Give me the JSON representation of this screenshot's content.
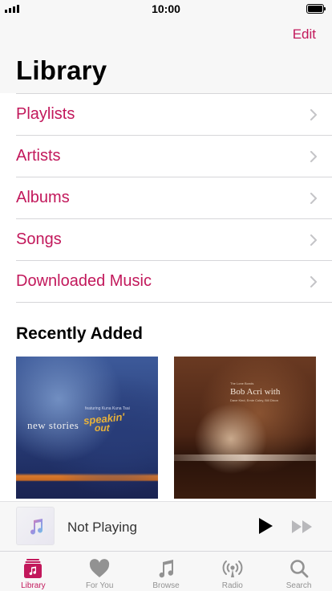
{
  "status_bar": {
    "time": "10:00"
  },
  "header": {
    "edit_label": "Edit",
    "title": "Library"
  },
  "menu": {
    "items": [
      {
        "label": "Playlists"
      },
      {
        "label": "Artists"
      },
      {
        "label": "Albums"
      },
      {
        "label": "Songs"
      },
      {
        "label": "Downloaded Music"
      }
    ]
  },
  "recently_added": {
    "title": "Recently Added",
    "albums": [
      {
        "cover_text_main": "new stories",
        "cover_text_accent_1": "speakin'",
        "cover_text_accent_2": "out",
        "cover_small_text": "featuring Kuna Kuna Tsai"
      },
      {
        "cover_small_top": "The Lone Bonds",
        "cover_text_main": "Bob Acri with",
        "cover_small_text": "Dave Kind, Ernie Coley, Bill Dixon"
      }
    ]
  },
  "mini_player": {
    "status": "Not Playing"
  },
  "tab_bar": {
    "active": "Library",
    "tabs": [
      {
        "label": "Library",
        "icon": "library-icon"
      },
      {
        "label": "For You",
        "icon": "heart-icon"
      },
      {
        "label": "Browse",
        "icon": "music-note-icon"
      },
      {
        "label": "Radio",
        "icon": "radio-icon"
      },
      {
        "label": "Search",
        "icon": "search-icon"
      }
    ]
  },
  "colors": {
    "accent": "#c2185b",
    "inactive": "#929292",
    "bar_background": "#f7f7f7",
    "separator": "#d6d6d9"
  }
}
